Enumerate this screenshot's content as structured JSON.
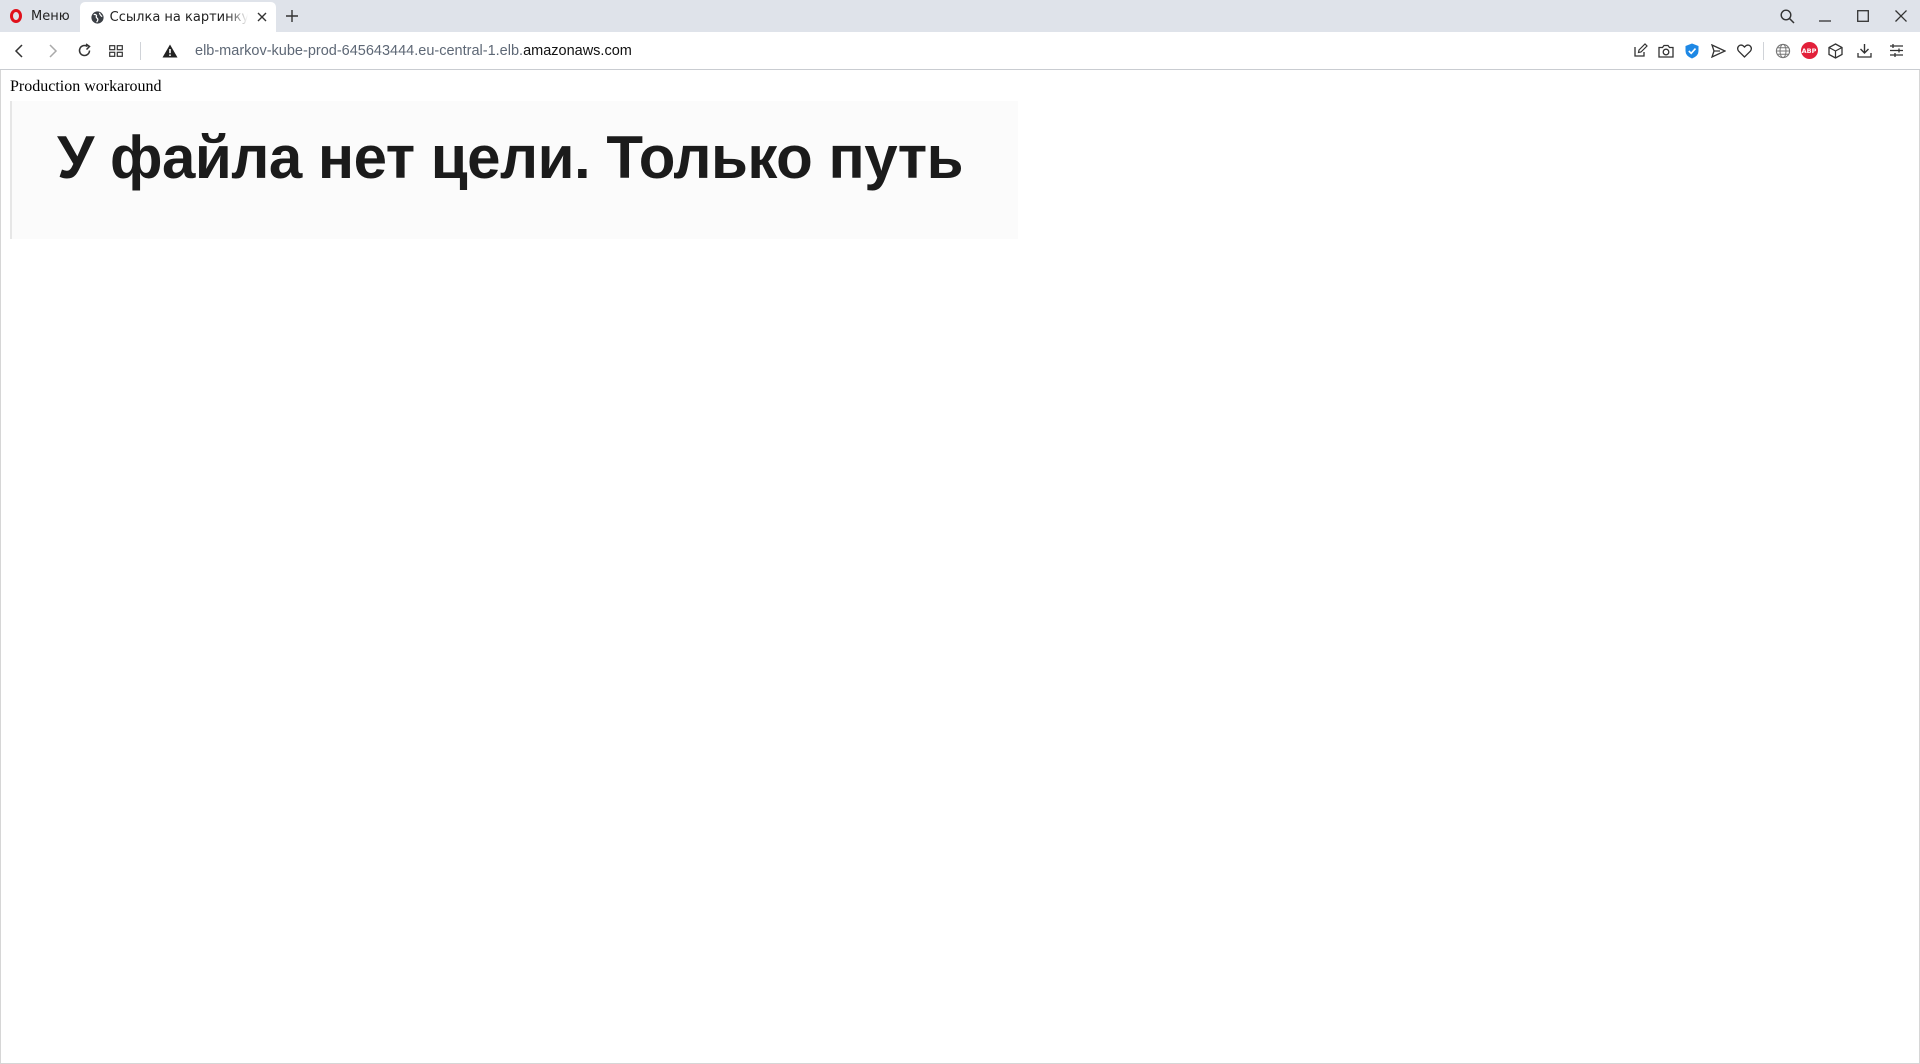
{
  "browser": {
    "menu_label": "Меню",
    "tab": {
      "title": "Ссылка на картинку для"
    },
    "address": {
      "subdomain": "elb-markov-kube-prod-645643444.eu-central-1.elb.",
      "domain": "amazonaws.com"
    },
    "icons": {
      "brand": "opera-logo",
      "adblock": "ABP"
    },
    "colors": {
      "opera_red": "#e0111b",
      "vpn_blue": "#1e88e5",
      "abp_red": "#e2203a"
    }
  },
  "page": {
    "text": "Production workaround",
    "image_caption": "У файла нет цели. Только путь"
  }
}
